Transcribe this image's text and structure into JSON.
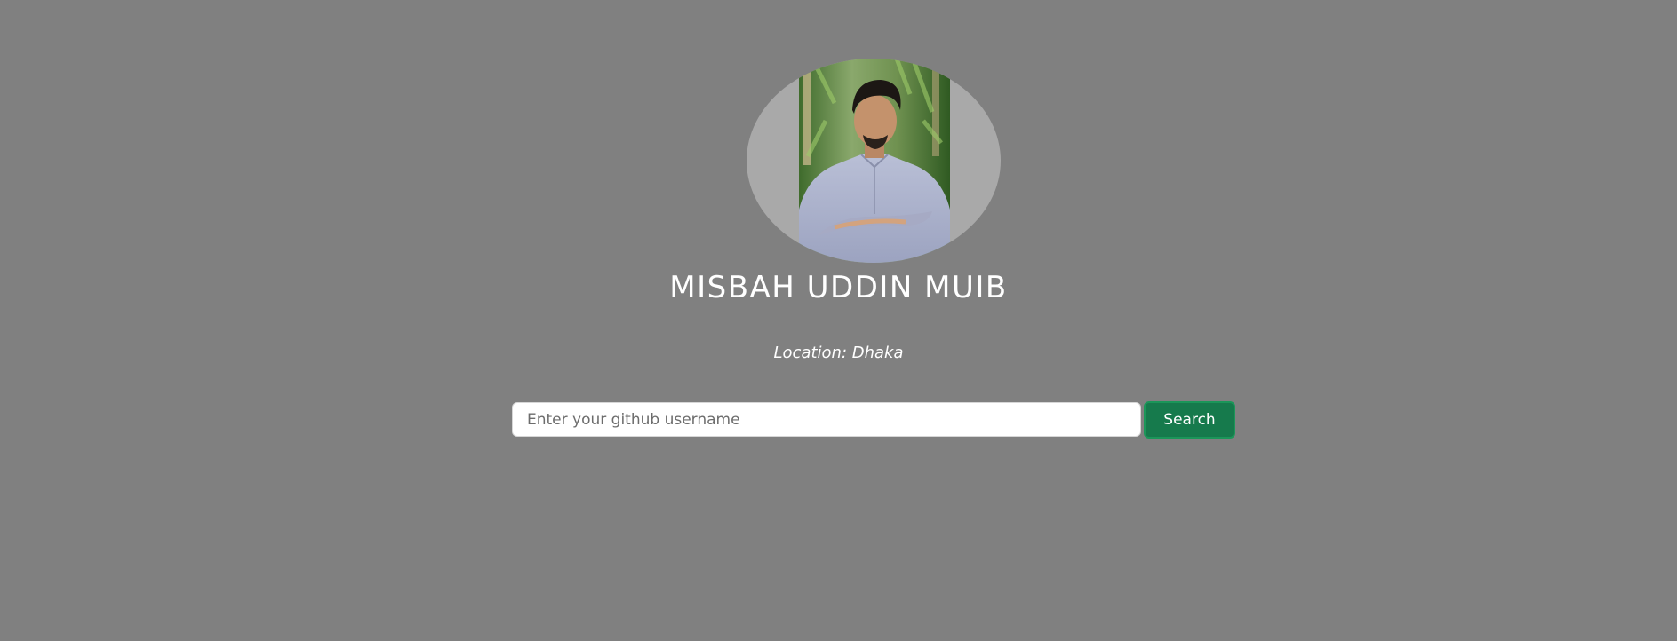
{
  "profile": {
    "avatar_alt": "profile photo",
    "name": "MISBAH UDDIN MUIB",
    "location": "Location: Dhaka"
  },
  "search": {
    "value": "",
    "placeholder": "Enter your github username",
    "button_label": "Search"
  },
  "colors": {
    "background": "#808080",
    "avatar_background": "#a9a9a9",
    "button": "#167a4c",
    "text": "#ffffff"
  }
}
